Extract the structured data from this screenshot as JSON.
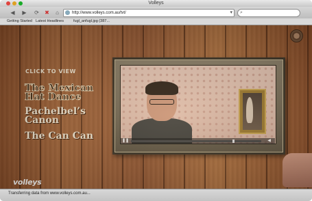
{
  "window": {
    "title": "Volleys"
  },
  "toolbar": {
    "url": "http://www.volleys.com.au/tvt/",
    "icons": [
      "back-arrow-icon",
      "forward-arrow-icon",
      "reload-icon",
      "stop-icon",
      "home-icon",
      "search-icon"
    ]
  },
  "bookmarks": [
    "Getting Started",
    "Latest Headlines",
    "fugl_anfugl.jpg (387..."
  ],
  "page": {
    "click_to_view": "CLICK TO VIEW",
    "songs": [
      {
        "title_line1": "The Mexican",
        "title_line2": "Hat Dance",
        "active": true
      },
      {
        "title_line1": "Pachelbel’s",
        "title_line2": "Canon",
        "active": false
      },
      {
        "title_line1": "The Can Can",
        "title_line2": "",
        "active": false
      }
    ],
    "video": {
      "progress": 0.79
    },
    "logo": "volleys"
  },
  "status": {
    "text": "Transferring data from www.volleys.com.au..."
  },
  "colors": {
    "wood": "#a8683b",
    "frame": "#5d5443",
    "accent_text": "#f4ead6"
  }
}
